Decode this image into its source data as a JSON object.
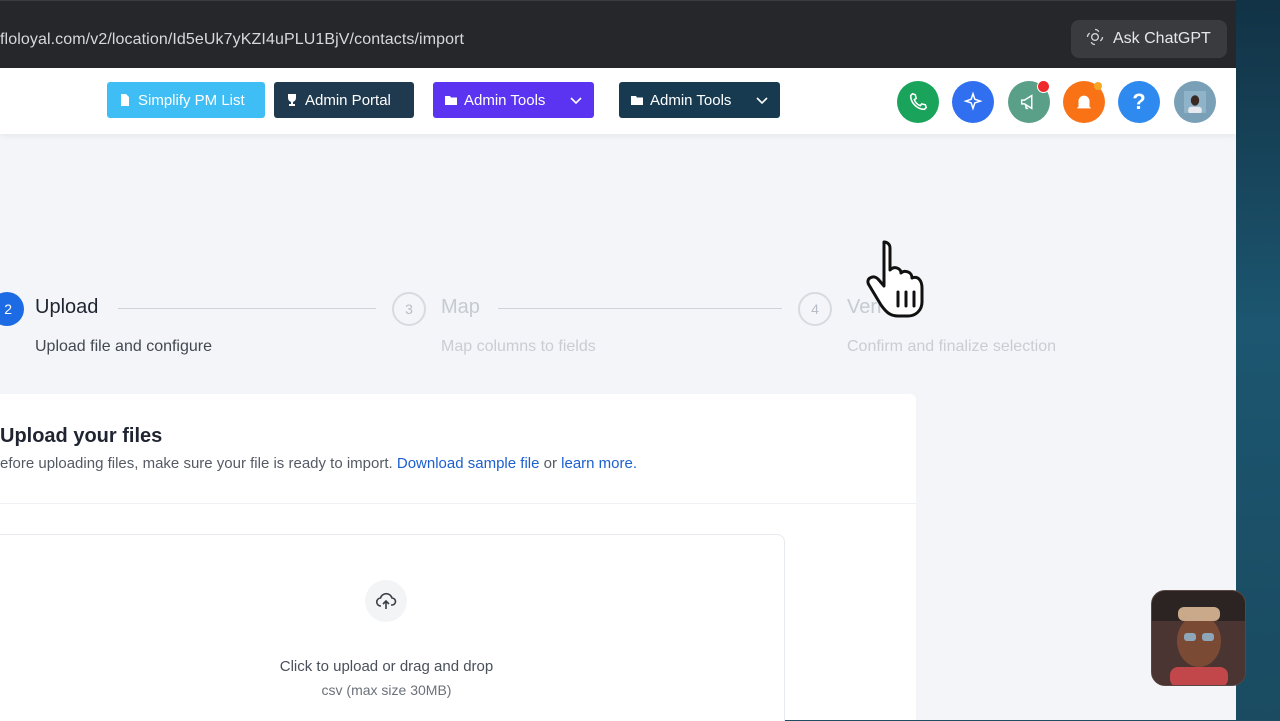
{
  "browser": {
    "url": "floloyal.com/v2/location/Id5eUk7yKZI4uPLU1BjV/contacts/import",
    "ask_label": "Ask ChatGPT"
  },
  "header": {
    "buttons": [
      {
        "label": "Simplify PM List",
        "color": "#3fbef5",
        "icon": "file-icon"
      },
      {
        "label": "Admin Portal",
        "color": "#1f3a4f",
        "icon": "trophy-icon"
      },
      {
        "label": "Admin Tools",
        "color": "#5b34f2",
        "icon": "folder-icon"
      },
      {
        "label": "Admin Tools",
        "color": "#173a50",
        "icon": "folder-icon"
      }
    ],
    "icons": [
      "phone-icon",
      "sparkle-icon",
      "megaphone-icon",
      "bell-icon",
      "help-icon",
      "avatar"
    ],
    "help_glyph": "?"
  },
  "steps": [
    {
      "number": "2",
      "title": "Upload",
      "description": "Upload file and configure",
      "active": true
    },
    {
      "number": "3",
      "title": "Map",
      "description": "Map columns to fields",
      "active": false
    },
    {
      "number": "4",
      "title": "Veri",
      "description": "Confirm and finalize selection",
      "active": false
    }
  ],
  "upload_card": {
    "title": "Upload your files",
    "desc_prefix": "efore uploading files, make sure your file is ready to import.",
    "download_link": "Download sample file",
    "or_text": "or",
    "learn_link": "learn more.",
    "dropzone_text": "Click to upload or drag and drop",
    "dropzone_subtext": "csv (max size 30MB)"
  }
}
